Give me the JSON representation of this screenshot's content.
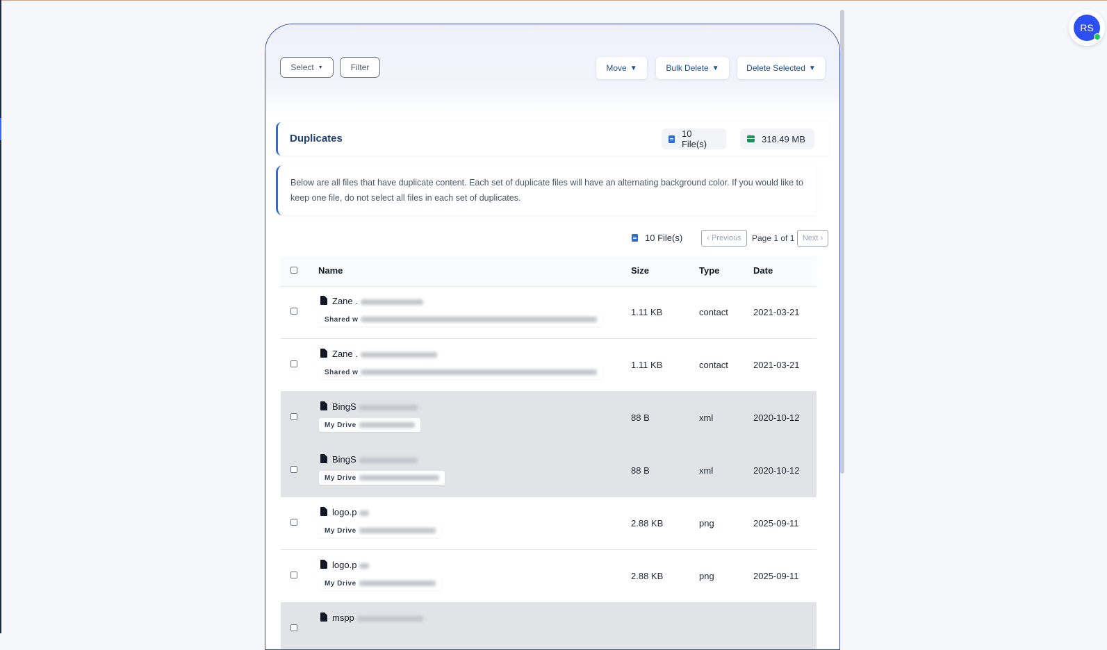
{
  "user": {
    "initials": "RS",
    "status_color": "#22c55e",
    "avatar_color": "#2b4ff2"
  },
  "toolbar": {
    "select_label": "Select",
    "filter_label": "Filter",
    "move_label": "Move",
    "bulk_delete_label": "Bulk Delete",
    "delete_selected_label": "Delete Selected"
  },
  "summary": {
    "title": "Duplicates",
    "file_count": "10 File(s)",
    "total_size": "318.49 MB"
  },
  "info_text": "Below are all files that have duplicate content. Each set of duplicate files will have an alternating background color. If you would like to keep one file, do not select all files in each set of duplicates.",
  "pagination": {
    "count": "10 File(s)",
    "previous_label": "‹ Previous",
    "page_text": "Page 1 of 1",
    "next_label": "Next ›"
  },
  "table": {
    "columns": [
      "Name",
      "Size",
      "Type",
      "Date"
    ],
    "rows": [
      {
        "name": "Zane .",
        "path": "Shared w",
        "size": "1.11 KB",
        "type": "contact",
        "date": "2021-03-21",
        "alt": false
      },
      {
        "name": "Zane .",
        "path": "Shared w",
        "size": "1.11 KB",
        "type": "contact",
        "date": "2021-03-21",
        "alt": false
      },
      {
        "name": "BingS",
        "path": "My Drive",
        "size": "88 B",
        "type": "xml",
        "date": "2020-10-12",
        "alt": true
      },
      {
        "name": "BingS",
        "path": "My Drive",
        "size": "88 B",
        "type": "xml",
        "date": "2020-10-12",
        "alt": true
      },
      {
        "name": "logo.p",
        "path": "My Drive",
        "size": "2.88 KB",
        "type": "png",
        "date": "2025-09-11",
        "alt": false
      },
      {
        "name": "logo.p",
        "path": "My Drive",
        "size": "2.88 KB",
        "type": "png",
        "date": "2025-09-11",
        "alt": false
      },
      {
        "name": "mspp",
        "path": "",
        "size": "",
        "type": "",
        "date": "",
        "alt": true
      }
    ]
  },
  "colors": {
    "accent": "#2f6bd6",
    "header_blue": "#1f3f73",
    "alt_row": "#e1e3e6"
  }
}
